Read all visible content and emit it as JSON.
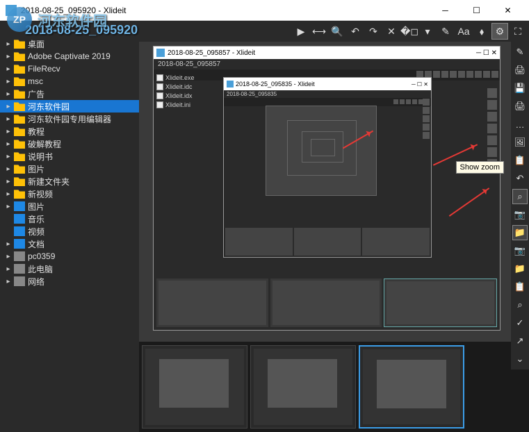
{
  "window": {
    "title": "2018-08-25_095920 - Xlideit",
    "app_name": "Xlideit"
  },
  "watermark": {
    "logo": "ZP",
    "text": "河东软件园"
  },
  "breadcrumb_overlay": "2018-08-25_095920",
  "toolbar": {
    "play": "▶",
    "zoom_fit": "⟷",
    "zoom": "🔍",
    "rotate_left": "↶",
    "rotate_right": "↷",
    "delete": "✕",
    "crop": "�◻",
    "more": "▾",
    "edit": "✎",
    "text": "Aa",
    "tag": "⬧",
    "settings": "⚙",
    "fullscreen": "⛶"
  },
  "sidebar": {
    "items": [
      {
        "label": "桌面",
        "icon": "folder",
        "expand": true
      },
      {
        "label": "Adobe Captivate 2019",
        "icon": "folder",
        "expand": true
      },
      {
        "label": "FileRecv",
        "icon": "folder",
        "expand": true
      },
      {
        "label": "msc",
        "icon": "folder",
        "expand": true
      },
      {
        "label": "广告",
        "icon": "folder",
        "expand": true
      },
      {
        "label": "河东软件园",
        "icon": "folder",
        "expand": true,
        "selected": true
      },
      {
        "label": "河东软件园专用编辑器",
        "icon": "folder",
        "expand": true
      },
      {
        "label": "教程",
        "icon": "folder",
        "expand": true
      },
      {
        "label": "破解教程",
        "icon": "folder",
        "expand": true
      },
      {
        "label": "说明书",
        "icon": "folder",
        "expand": true
      },
      {
        "label": "图片",
        "icon": "folder",
        "expand": true
      },
      {
        "label": "新建文件夹",
        "icon": "folder",
        "expand": true
      },
      {
        "label": "新视频",
        "icon": "folder",
        "expand": true
      },
      {
        "label": "图片",
        "icon": "pic",
        "expand": true
      },
      {
        "label": "音乐",
        "icon": "music",
        "expand": false
      },
      {
        "label": "视频",
        "icon": "video",
        "expand": false
      },
      {
        "label": "文档",
        "icon": "doc",
        "expand": true
      },
      {
        "label": "pc0359",
        "icon": "drive",
        "expand": true
      },
      {
        "label": "此电脑",
        "icon": "pc",
        "expand": true
      },
      {
        "label": "网络",
        "icon": "net",
        "expand": true
      }
    ]
  },
  "nested": {
    "w1_title": "2018-08-25_095857 - Xlideit",
    "w1_breadcrumb": "2018-08-25_095857",
    "w2_title": "2018-08-25_095835 - Xlideit",
    "w2_breadcrumb": "2018-08-25_095835",
    "files": [
      {
        "name": "Xlideit.exe"
      },
      {
        "name": "Xlideit.idc"
      },
      {
        "name": "Xlideit.idx"
      },
      {
        "name": "Xlideit.ini"
      }
    ]
  },
  "tooltip": {
    "show_zoom": "Show zoom"
  },
  "vtoolbar_icons": [
    "✎",
    "🖨",
    "💾",
    "🖨",
    "…",
    "🖼",
    "📋",
    "↶",
    "⌕",
    "📷",
    "📁",
    "📷",
    "📁",
    "📋",
    "⌕",
    "✓",
    "↗",
    "⌄"
  ],
  "filmstrip": {
    "count": 3,
    "selected_index": 2
  }
}
